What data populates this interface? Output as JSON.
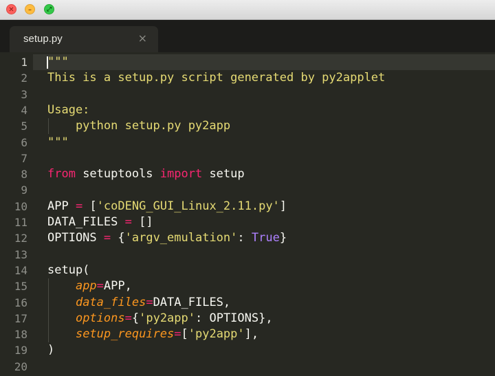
{
  "window": {
    "traffic_lights": [
      {
        "name": "close",
        "glyph": "✕",
        "color": "#fc605c"
      },
      {
        "name": "minimize",
        "glyph": "–",
        "color": "#fdbc40"
      },
      {
        "name": "zoom",
        "glyph": "⤢",
        "color": "#34c84a"
      }
    ]
  },
  "tabs": [
    {
      "label": "setup.py",
      "close_glyph": "×",
      "active": true
    }
  ],
  "editor": {
    "current_line": 1,
    "line_numbers": [
      "1",
      "2",
      "3",
      "4",
      "5",
      "6",
      "7",
      "8",
      "9",
      "10",
      "11",
      "12",
      "13",
      "14",
      "15",
      "16",
      "17",
      "18",
      "19",
      "20"
    ],
    "lines": [
      {
        "tokens": [
          {
            "t": "\"\"\"",
            "c": "str"
          }
        ]
      },
      {
        "tokens": [
          {
            "t": "This is a setup.py script generated by py2applet",
            "c": "str"
          }
        ]
      },
      {
        "tokens": []
      },
      {
        "tokens": [
          {
            "t": "Usage:",
            "c": "str"
          }
        ]
      },
      {
        "tokens": [
          {
            "t": "    python setup.py py2app",
            "c": "str"
          }
        ]
      },
      {
        "tokens": [
          {
            "t": "\"\"\"",
            "c": "str"
          }
        ]
      },
      {
        "tokens": []
      },
      {
        "tokens": [
          {
            "t": "from",
            "c": "kw"
          },
          {
            "t": " setuptools ",
            "c": "plain"
          },
          {
            "t": "import",
            "c": "kw"
          },
          {
            "t": " setup",
            "c": "plain"
          }
        ]
      },
      {
        "tokens": []
      },
      {
        "tokens": [
          {
            "t": "APP ",
            "c": "plain"
          },
          {
            "t": "=",
            "c": "op"
          },
          {
            "t": " [",
            "c": "plain"
          },
          {
            "t": "'coDENG_GUI_Linux_2.11.py'",
            "c": "str"
          },
          {
            "t": "]",
            "c": "plain"
          }
        ]
      },
      {
        "tokens": [
          {
            "t": "DATA_FILES ",
            "c": "plain"
          },
          {
            "t": "=",
            "c": "op"
          },
          {
            "t": " []",
            "c": "plain"
          }
        ]
      },
      {
        "tokens": [
          {
            "t": "OPTIONS ",
            "c": "plain"
          },
          {
            "t": "=",
            "c": "op"
          },
          {
            "t": " {",
            "c": "plain"
          },
          {
            "t": "'argv_emulation'",
            "c": "str"
          },
          {
            "t": ": ",
            "c": "plain"
          },
          {
            "t": "True",
            "c": "const"
          },
          {
            "t": "}",
            "c": "plain"
          }
        ]
      },
      {
        "tokens": []
      },
      {
        "tokens": [
          {
            "t": "setup(",
            "c": "plain"
          }
        ]
      },
      {
        "tokens": [
          {
            "t": "    ",
            "c": "plain"
          },
          {
            "t": "app",
            "c": "param"
          },
          {
            "t": "=",
            "c": "op"
          },
          {
            "t": "APP,",
            "c": "plain"
          }
        ]
      },
      {
        "tokens": [
          {
            "t": "    ",
            "c": "plain"
          },
          {
            "t": "data_files",
            "c": "param"
          },
          {
            "t": "=",
            "c": "op"
          },
          {
            "t": "DATA_FILES,",
            "c": "plain"
          }
        ]
      },
      {
        "tokens": [
          {
            "t": "    ",
            "c": "plain"
          },
          {
            "t": "options",
            "c": "param"
          },
          {
            "t": "=",
            "c": "op"
          },
          {
            "t": "{",
            "c": "plain"
          },
          {
            "t": "'py2app'",
            "c": "str"
          },
          {
            "t": ": OPTIONS},",
            "c": "plain"
          }
        ]
      },
      {
        "tokens": [
          {
            "t": "    ",
            "c": "plain"
          },
          {
            "t": "setup_requires",
            "c": "param"
          },
          {
            "t": "=",
            "c": "op"
          },
          {
            "t": "[",
            "c": "plain"
          },
          {
            "t": "'py2app'",
            "c": "str"
          },
          {
            "t": "],",
            "c": "plain"
          }
        ]
      },
      {
        "tokens": [
          {
            "t": ")",
            "c": "plain"
          }
        ]
      },
      {
        "tokens": []
      }
    ]
  }
}
